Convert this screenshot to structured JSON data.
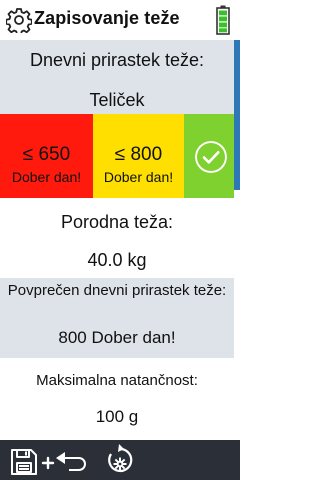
{
  "header": {
    "title": "Zapisovanje teže",
    "settings_icon": "gear-icon",
    "battery_icon": "battery-icon",
    "battery_level": 0.85,
    "battery_color": "#39c12a"
  },
  "daily_gain": {
    "label": "Dnevni prirastek teže:",
    "animal": "Teliček"
  },
  "thresholds": [
    {
      "value": "≤ 650",
      "message": "Dober dan!",
      "color": "#ff1a0d"
    },
    {
      "value": "≤ 800",
      "message": "Dober dan!",
      "color": "#ffdf00"
    },
    {
      "icon": "check-icon",
      "color": "#7fd12f"
    }
  ],
  "birth_weight": {
    "label": "Porodna teža:",
    "value": "40.0 kg"
  },
  "average_gain": {
    "label": "Povprečen dnevni prirastek teže:",
    "value": "800 Dober dan!"
  },
  "precision": {
    "label": "Maksimalna natančnost:",
    "value": "100 g"
  },
  "footer": {
    "save_add_icon": "save-add-undo-icon",
    "reset_icon": "reset-icon",
    "background": "#2b3038"
  }
}
